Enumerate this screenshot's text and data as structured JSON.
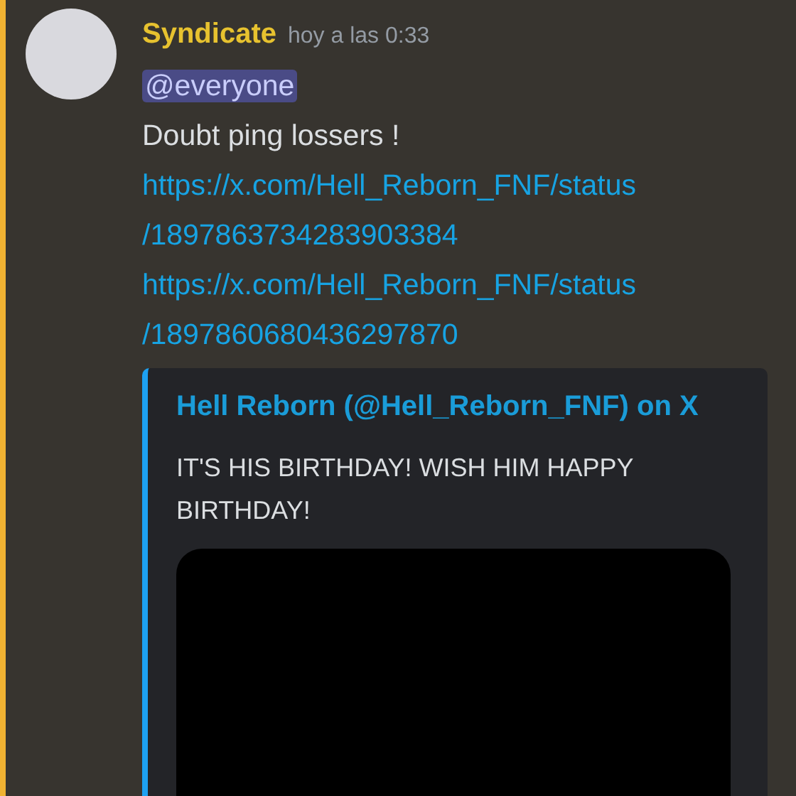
{
  "message": {
    "author": "Syndicate",
    "timestamp": "hoy a las 0:33",
    "mentions_me": true,
    "mention": "@everyone",
    "text": "Doubt ping lossers !",
    "links": [
      {
        "lines": [
          "https://x.com/Hell_Reborn_FNF/status",
          "/1897863734283903384"
        ]
      },
      {
        "lines": [
          "https://x.com/Hell_Reborn_FNF/status",
          "/1897860680436297870"
        ]
      }
    ],
    "embed": {
      "title": "Hell Reborn (@Hell_Reborn_FNF) on X",
      "description": "IT'S HIS BIRTHDAY! WISH HIM HAPPY BIRTHDAY!",
      "media": {
        "kind": "video"
      }
    }
  }
}
